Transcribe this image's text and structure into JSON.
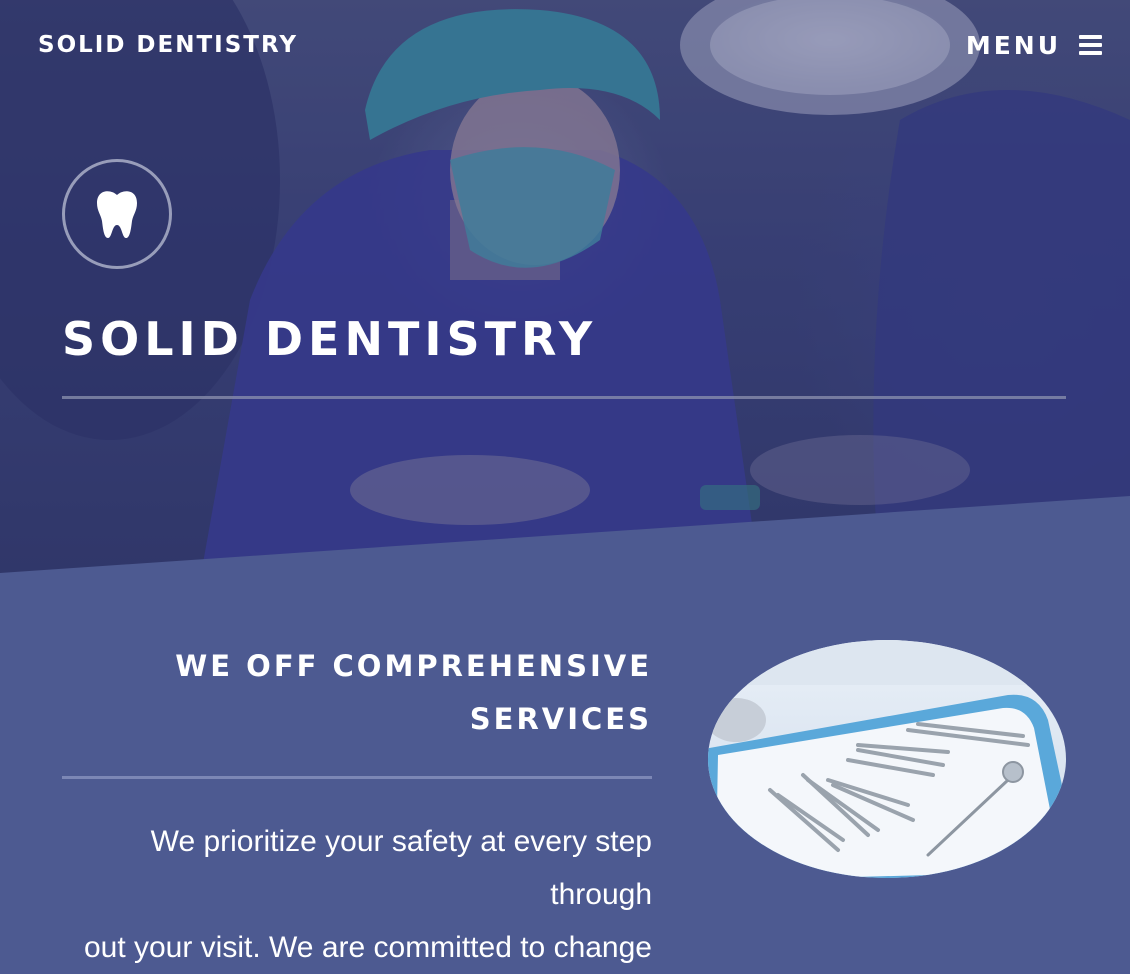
{
  "nav": {
    "brand": "SOLID DENTISTRY",
    "menu_label": "MENU",
    "menu_icon": "hamburger-icon"
  },
  "hero": {
    "badge_icon": "tooth-icon",
    "title": "SOLID DENTISTRY",
    "background": "photo of a dentist in scrubs, surgical cap and mask",
    "overlay_color": "#3a3f7e"
  },
  "services": {
    "heading_line1": "WE OFF COMPREHENSIVE",
    "heading_line2": "SERVICES",
    "body_line1": "We prioritize your safety at every step through",
    "body_line2": "out your visit. We are committed to change",
    "image": "tray of dental instruments"
  },
  "colors": {
    "accent_band": "#4d5a91",
    "text": "#ffffff",
    "tray_blue": "#4fa3d6"
  }
}
